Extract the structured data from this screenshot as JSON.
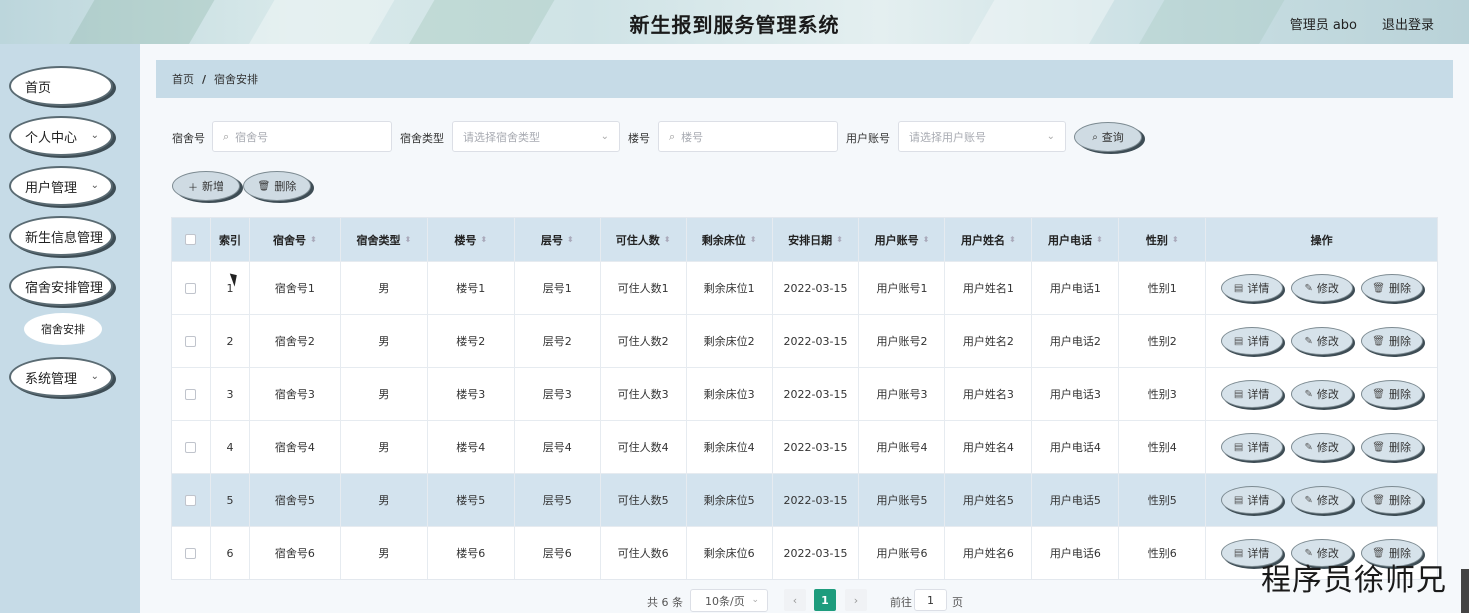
{
  "header": {
    "title": "新生报到服务管理系统",
    "user": "管理员 abo",
    "logout": "退出登录"
  },
  "sidebar": {
    "items": [
      {
        "label": "首页",
        "has_children": false
      },
      {
        "label": "个人中心",
        "has_children": true
      },
      {
        "label": "用户管理",
        "has_children": true
      },
      {
        "label": "新生信息管理",
        "has_children": false
      },
      {
        "label": "宿舍安排管理",
        "has_children": false
      },
      {
        "label": "系统管理",
        "has_children": true
      }
    ],
    "subitem": "宿舍安排"
  },
  "breadcrumb": {
    "home": "首页",
    "sep": "/",
    "current": "宿舍安排"
  },
  "search": {
    "dorm_label": "宿舍号",
    "dorm_placeholder": "宿舍号",
    "type_label": "宿舍类型",
    "type_placeholder": "请选择宿舍类型",
    "building_label": "楼号",
    "building_placeholder": "楼号",
    "account_label": "用户账号",
    "account_placeholder": "请选择用户账号",
    "query_button": "查询"
  },
  "actions": {
    "add": "新增",
    "delete": "删除"
  },
  "table": {
    "headers": [
      "索引",
      "宿舍号",
      "宿舍类型",
      "楼号",
      "层号",
      "可住人数",
      "剩余床位",
      "安排日期",
      "用户账号",
      "用户姓名",
      "用户电话",
      "性别",
      "操作"
    ],
    "rows": [
      [
        "1",
        "宿舍号1",
        "男",
        "楼号1",
        "层号1",
        "可住人数1",
        "剩余床位1",
        "2022-03-15",
        "用户账号1",
        "用户姓名1",
        "用户电话1",
        "性别1"
      ],
      [
        "2",
        "宿舍号2",
        "男",
        "楼号2",
        "层号2",
        "可住人数2",
        "剩余床位2",
        "2022-03-15",
        "用户账号2",
        "用户姓名2",
        "用户电话2",
        "性别2"
      ],
      [
        "3",
        "宿舍号3",
        "男",
        "楼号3",
        "层号3",
        "可住人数3",
        "剩余床位3",
        "2022-03-15",
        "用户账号3",
        "用户姓名3",
        "用户电话3",
        "性别3"
      ],
      [
        "4",
        "宿舍号4",
        "男",
        "楼号4",
        "层号4",
        "可住人数4",
        "剩余床位4",
        "2022-03-15",
        "用户账号4",
        "用户姓名4",
        "用户电话4",
        "性别4"
      ],
      [
        "5",
        "宿舍号5",
        "男",
        "楼号5",
        "层号5",
        "可住人数5",
        "剩余床位5",
        "2022-03-15",
        "用户账号5",
        "用户姓名5",
        "用户电话5",
        "性别5"
      ],
      [
        "6",
        "宿舍号6",
        "男",
        "楼号6",
        "层号6",
        "可住人数6",
        "剩余床位6",
        "2022-03-15",
        "用户账号6",
        "用户姓名6",
        "用户电话6",
        "性别6"
      ]
    ],
    "highlighted_row": 4,
    "op_labels": {
      "detail": "详情",
      "edit": "修改",
      "delete": "删除"
    }
  },
  "pagination": {
    "total": "共 6 条",
    "page_size": "10条/页",
    "prev": "‹",
    "current": "1",
    "next": "›",
    "goto_prefix": "前往",
    "goto_value": "1",
    "goto_suffix": "页"
  },
  "watermark": "程序员徐师兄",
  "colors": {
    "accent": "#1e9c7d",
    "panel": "#c6dbe7",
    "header_row": "#d3e3ee"
  }
}
